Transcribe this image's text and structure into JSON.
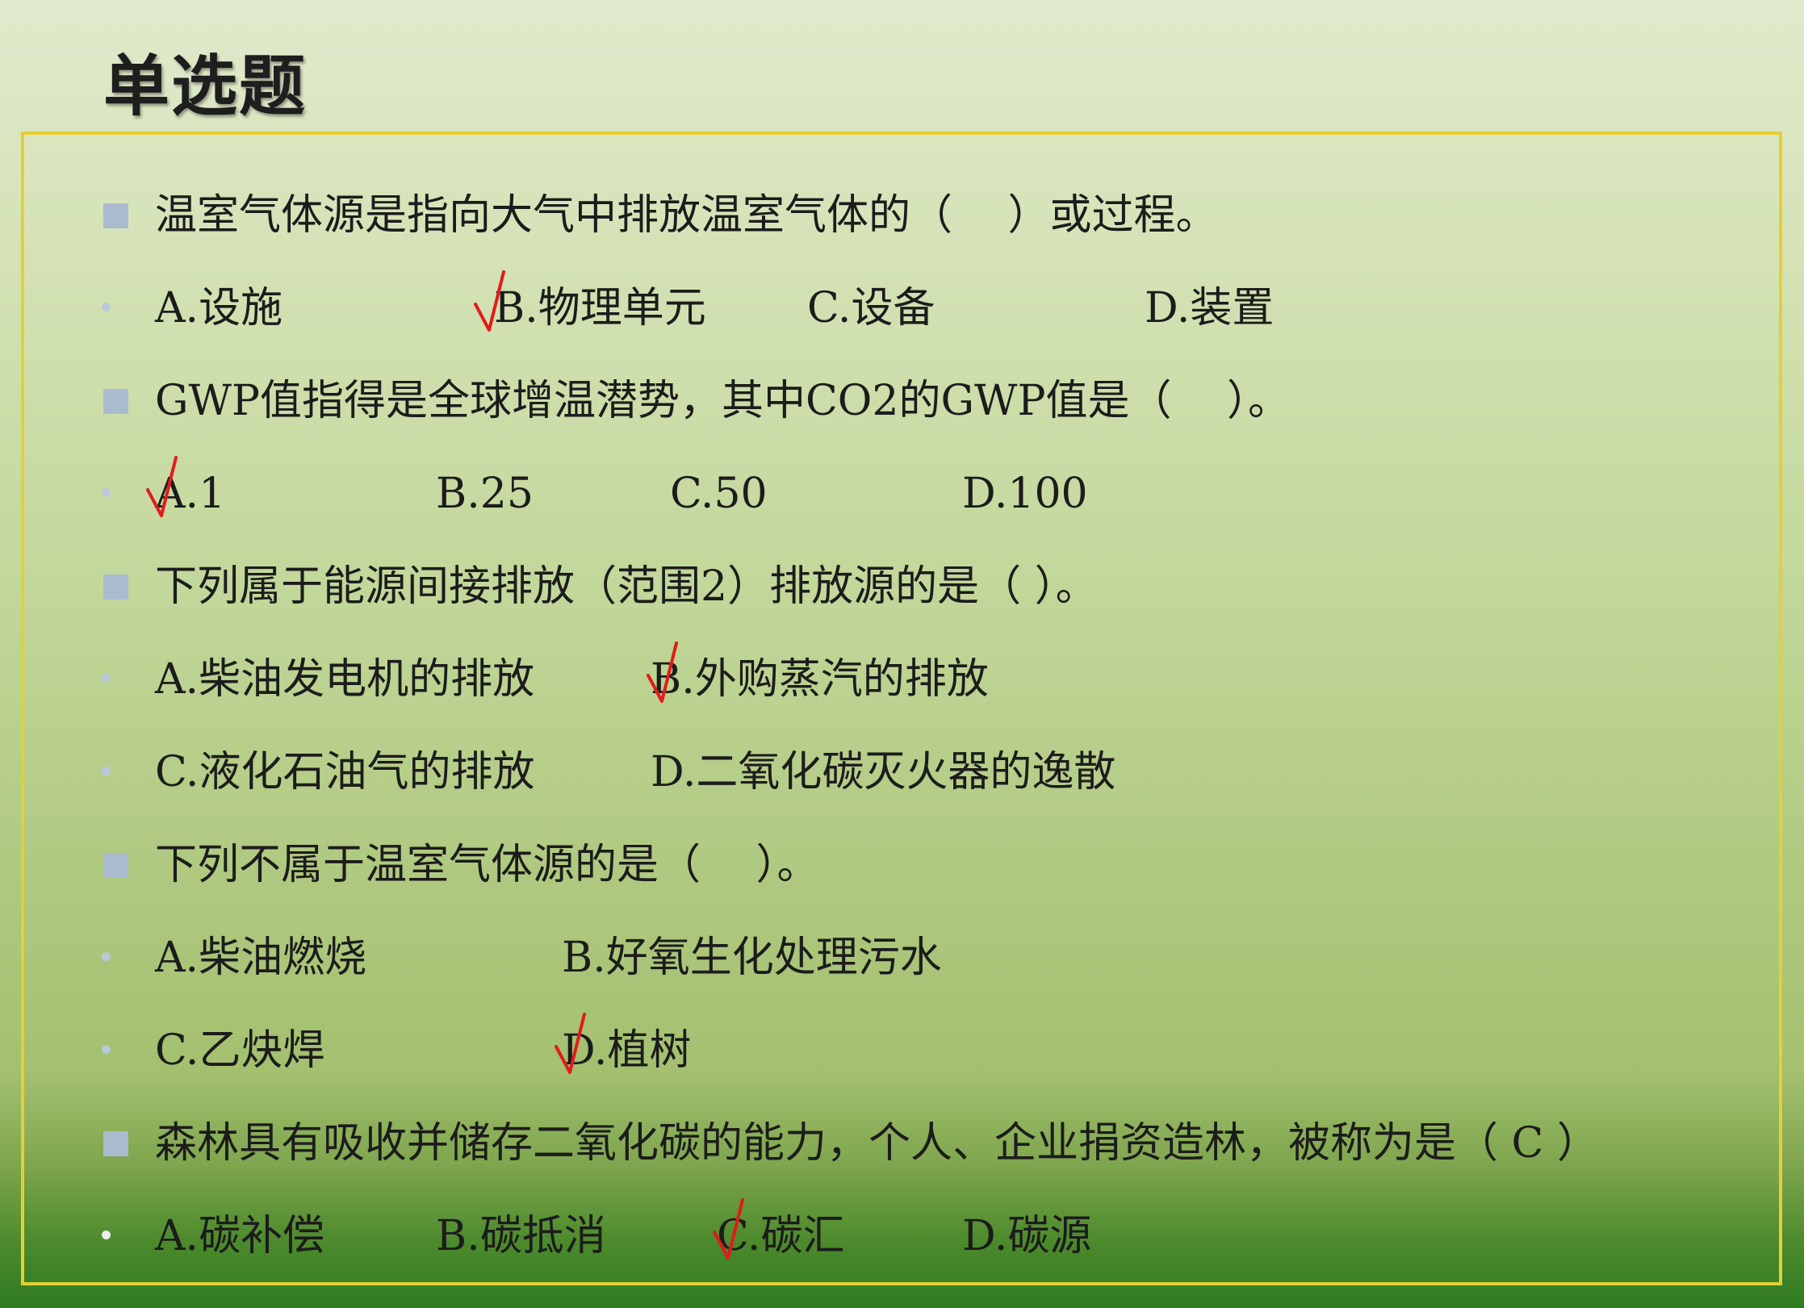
{
  "title": "单选题",
  "colors": {
    "frame": "#e6cf33",
    "check_mark": "#e11b1b",
    "bullet": "#aabbd0"
  },
  "q1": {
    "question": "温室气体源是指向大气中排放温室气体的（　 ）或过程。",
    "options": [
      "A.设施",
      "B.物理单元",
      "C.设备",
      "D.装置"
    ],
    "checked": "B"
  },
  "q2": {
    "question": "GWP值指得是全球增温潜势，其中CO2的GWP值是（　 ）。",
    "options": [
      "A.1",
      "B.25",
      "C.50",
      "D.100"
    ],
    "checked": "A"
  },
  "q3": {
    "question": "下列属于能源间接排放（范围2）排放源的是（ ）。",
    "options": [
      "A.柴油发电机的排放",
      "B.外购蒸汽的排放",
      "C.液化石油气的排放",
      "D.二氧化碳灭火器的逸散"
    ],
    "checked": "B"
  },
  "q4": {
    "question": "下列不属于温室气体源的是（　 ）。",
    "options": [
      "A.柴油燃烧",
      "B.好氧生化处理污水",
      "C.乙炔焊",
      "D.植树"
    ],
    "checked": "D"
  },
  "q5": {
    "question": "森林具有吸收并储存二氧化碳的能力，个人、企业捐资造林，被称为是（ C ）",
    "options": [
      "A.碳补偿",
      "B.碳抵消",
      "C.碳汇",
      "D.碳源"
    ],
    "checked": "C"
  }
}
